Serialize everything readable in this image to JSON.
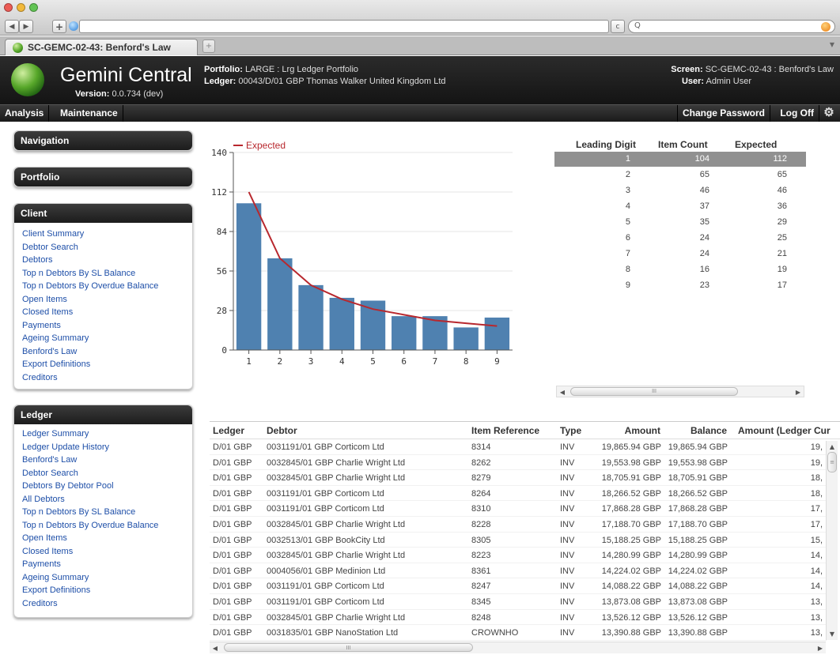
{
  "browser": {
    "tab_title": "SC-GEMC-02-43: Benford's Law",
    "reload_symbol": "c",
    "search_symbol": "Q"
  },
  "app": {
    "name": "Gemini Central",
    "version_label": "Version:",
    "version": "0.0.734 (dev)",
    "portfolio_label": "Portfolio:",
    "portfolio": "LARGE : Lrg Ledger Portfolio",
    "ledger_label": "Ledger:",
    "ledger": "00043/D/01 GBP Thomas Walker United Kingdom Ltd",
    "screen_label": "Screen:",
    "screen": "SC-GEMC-02-43 : Benford's Law",
    "user_label": "User:",
    "user": "Admin User"
  },
  "menu": {
    "analysis": "Analysis",
    "maintenance": "Maintenance",
    "change_password": "Change Password",
    "log_off": "Log Off"
  },
  "sidebar": {
    "navigation": {
      "title": "Navigation"
    },
    "portfolio": {
      "title": "Portfolio"
    },
    "client": {
      "title": "Client",
      "links": [
        "Client Summary",
        "Debtor Search",
        "Debtors",
        "Top n Debtors By SL Balance",
        "Top n Debtors By Overdue Balance",
        "Open Items",
        "Closed Items",
        "Payments",
        "Ageing Summary",
        "Benford's Law",
        "Export Definitions",
        "Creditors"
      ]
    },
    "ledger": {
      "title": "Ledger",
      "links": [
        "Ledger Summary",
        "Ledger Update History",
        "Benford's Law",
        "Debtor Search",
        "Debtors By Debtor Pool",
        "All Debtors",
        "Top n Debtors By SL Balance",
        "Top n Debtors By Overdue Balance",
        "Open Items",
        "Closed Items",
        "Payments",
        "Ageing Summary",
        "Export Definitions",
        "Creditors"
      ]
    }
  },
  "chart_data": {
    "type": "bar",
    "categories": [
      "1",
      "2",
      "3",
      "4",
      "5",
      "6",
      "7",
      "8",
      "9"
    ],
    "series": [
      {
        "name": "",
        "type": "bar",
        "values": [
          104,
          65,
          46,
          37,
          35,
          24,
          24,
          16,
          23
        ]
      },
      {
        "name": "Expected",
        "type": "line",
        "values": [
          112,
          65,
          46,
          36,
          29,
          25,
          21,
          19,
          17
        ]
      }
    ],
    "ylim": [
      0,
      140
    ],
    "yticks": [
      "0",
      "28",
      "56",
      "84",
      "112",
      "140"
    ],
    "legend": "top-left",
    "grid": true,
    "colors": {
      "bar": "#4f81b0",
      "line": "#b8282e"
    }
  },
  "digits_table": {
    "headers": [
      "Leading Digit",
      "Item Count",
      "Expected"
    ],
    "rows": [
      [
        "1",
        "104",
        "112"
      ],
      [
        "2",
        "65",
        "65"
      ],
      [
        "3",
        "46",
        "46"
      ],
      [
        "4",
        "37",
        "36"
      ],
      [
        "5",
        "35",
        "29"
      ],
      [
        "6",
        "24",
        "25"
      ],
      [
        "7",
        "24",
        "21"
      ],
      [
        "8",
        "16",
        "19"
      ],
      [
        "9",
        "23",
        "17"
      ]
    ],
    "scroll_grip": "III"
  },
  "items_table": {
    "headers": [
      "Ledger",
      "Debtor",
      "Item Reference",
      "Type",
      "Amount",
      "Balance",
      "Amount (Ledger Cur"
    ],
    "rows": [
      [
        "D/01 GBP",
        "0031191/01 GBP Corticom Ltd",
        "8314",
        "INV",
        "19,865.94 GBP",
        "19,865.94 GBP",
        "19,"
      ],
      [
        "D/01 GBP",
        "0032845/01 GBP Charlie Wright Ltd",
        "8262",
        "INV",
        "19,553.98 GBP",
        "19,553.98 GBP",
        "19,"
      ],
      [
        "D/01 GBP",
        "0032845/01 GBP Charlie Wright Ltd",
        "8279",
        "INV",
        "18,705.91 GBP",
        "18,705.91 GBP",
        "18,"
      ],
      [
        "D/01 GBP",
        "0031191/01 GBP Corticom Ltd",
        "8264",
        "INV",
        "18,266.52 GBP",
        "18,266.52 GBP",
        "18,"
      ],
      [
        "D/01 GBP",
        "0031191/01 GBP Corticom Ltd",
        "8310",
        "INV",
        "17,868.28 GBP",
        "17,868.28 GBP",
        "17,"
      ],
      [
        "D/01 GBP",
        "0032845/01 GBP Charlie Wright Ltd",
        "8228",
        "INV",
        "17,188.70 GBP",
        "17,188.70 GBP",
        "17,"
      ],
      [
        "D/01 GBP",
        "0032513/01 GBP BookCity Ltd",
        "8305",
        "INV",
        "15,188.25 GBP",
        "15,188.25 GBP",
        "15,"
      ],
      [
        "D/01 GBP",
        "0032845/01 GBP Charlie Wright Ltd",
        "8223",
        "INV",
        "14,280.99 GBP",
        "14,280.99 GBP",
        "14,"
      ],
      [
        "D/01 GBP",
        "0004056/01 GBP Medinion Ltd",
        "8361",
        "INV",
        "14,224.02 GBP",
        "14,224.02 GBP",
        "14,"
      ],
      [
        "D/01 GBP",
        "0031191/01 GBP Corticom Ltd",
        "8247",
        "INV",
        "14,088.22 GBP",
        "14,088.22 GBP",
        "14,"
      ],
      [
        "D/01 GBP",
        "0031191/01 GBP Corticom Ltd",
        "8345",
        "INV",
        "13,873.08 GBP",
        "13,873.08 GBP",
        "13,"
      ],
      [
        "D/01 GBP",
        "0032845/01 GBP Charlie Wright Ltd",
        "8248",
        "INV",
        "13,526.12 GBP",
        "13,526.12 GBP",
        "13,"
      ],
      [
        "D/01 GBP",
        "0031835/01 GBP NanoStation Ltd",
        "CROWNHO",
        "INV",
        "13,390.88 GBP",
        "13,390.88 GBP",
        "13,"
      ]
    ],
    "scroll_grip": "III"
  }
}
